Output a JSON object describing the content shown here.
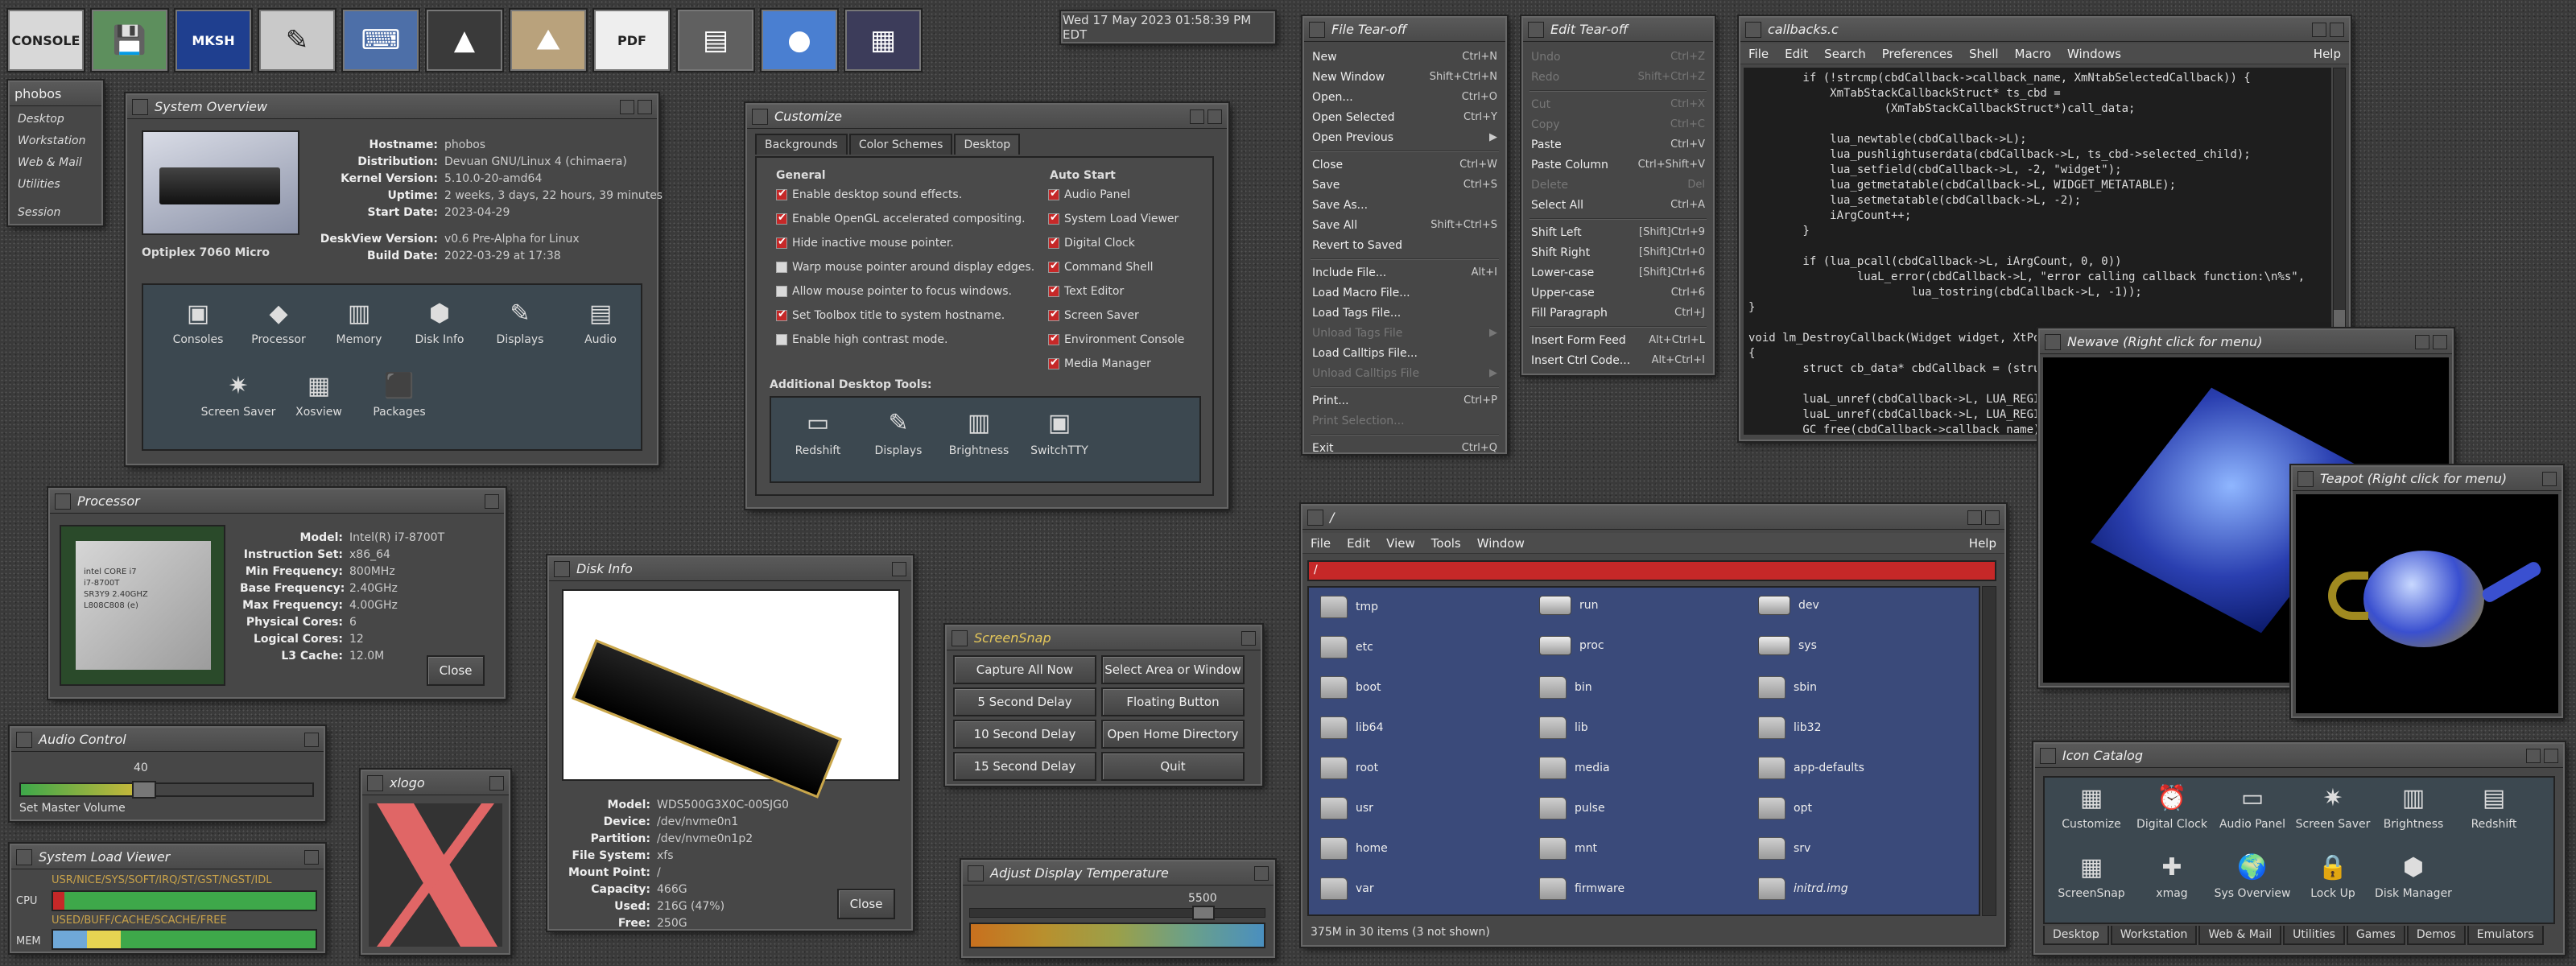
{
  "launcher": [
    {
      "name": "console-launcher",
      "label": "CONSOLE",
      "bg": "#d8d8d8"
    },
    {
      "name": "disk-launcher",
      "label": "💾",
      "bg": "#5d8f5d"
    },
    {
      "name": "mksh-launcher",
      "label": "MKSH",
      "bg": "#1f3f8f"
    },
    {
      "name": "editor-launcher",
      "label": "✎",
      "bg": "#c9c9c9"
    },
    {
      "name": "keyboard-launcher",
      "label": "⌨",
      "bg": "#4d6fa8"
    },
    {
      "name": "vlc-launcher",
      "label": "▲",
      "bg": "#3a3a3a"
    },
    {
      "name": "desert-launcher",
      "label": "⛰",
      "bg": "#b9a27c"
    },
    {
      "name": "pdf-launcher",
      "label": "PDF",
      "bg": "#eeeeee"
    },
    {
      "name": "files-launcher",
      "label": "▤",
      "bg": "#606060"
    },
    {
      "name": "globe-launcher",
      "label": "●",
      "bg": "#4a7fd1"
    },
    {
      "name": "workspaces-launcher",
      "label": "▦",
      "bg": "#3c3c5a"
    }
  ],
  "clock": "Wed 17 May 2023 01:58:39 PM EDT",
  "root_menu": {
    "title": "phobos",
    "items": [
      "Desktop",
      "Workstation",
      "Web & Mail",
      "Utilities",
      "Session"
    ]
  },
  "system_overview": {
    "title": "System Overview",
    "hostname_k": "Hostname:",
    "hostname": "phobos",
    "dist_k": "Distribution:",
    "dist": "Devuan GNU/Linux 4 (chimaera)",
    "kernel_k": "Kernel Version:",
    "kernel": "5.10.0-20-amd64",
    "uptime_k": "Uptime:",
    "uptime": "2 weeks, 3 days, 22 hours, 39 minutes",
    "start_k": "Start Date:",
    "start": "2023-04-29",
    "deskview_k": "DeskView Version:",
    "deskview": "v0.6 Pre-Alpha for Linux",
    "build_k": "Build Date:",
    "build": "2022-03-29 at 17:38",
    "machine": "Optiplex 7060 Micro",
    "icons": [
      "Consoles",
      "Processor",
      "Memory",
      "Disk Info",
      "Displays",
      "Audio",
      "Screen Saver",
      "Xosview",
      "Packages"
    ]
  },
  "customize": {
    "title": "Customize",
    "tabs": [
      "Backgrounds",
      "Color Schemes",
      "Desktop"
    ],
    "general_h": "General",
    "autostart_h": "Auto Start",
    "general": [
      {
        "t": "Enable desktop sound effects.",
        "on": true
      },
      {
        "t": "Enable OpenGL accelerated compositing.",
        "on": true
      },
      {
        "t": "Hide inactive mouse pointer.",
        "on": true
      },
      {
        "t": "Warp mouse pointer around display edges.",
        "on": false
      },
      {
        "t": "Allow mouse pointer to focus windows.",
        "on": false
      },
      {
        "t": "Set Toolbox title to system hostname.",
        "on": true
      },
      {
        "t": "Enable high contrast mode.",
        "on": false
      }
    ],
    "autostart": [
      {
        "t": "Audio Panel",
        "on": true
      },
      {
        "t": "System Load Viewer",
        "on": true
      },
      {
        "t": "Digital Clock",
        "on": true
      },
      {
        "t": "Command Shell",
        "on": true
      },
      {
        "t": "Text Editor",
        "on": true
      },
      {
        "t": "Screen Saver",
        "on": true
      },
      {
        "t": "Environment Console",
        "on": true
      },
      {
        "t": "Media Manager",
        "on": true
      }
    ],
    "tools_h": "Additional Desktop Tools:",
    "tools": [
      "Redshift",
      "Displays",
      "Brightness",
      "SwitchTTY"
    ]
  },
  "file_tearoff": {
    "title": "File Tear-off",
    "items": [
      {
        "t": "New",
        "a": "Ctrl+N"
      },
      {
        "t": "New Window",
        "a": "Shift+Ctrl+N"
      },
      {
        "t": "Open...",
        "a": "Ctrl+O"
      },
      {
        "t": "Open Selected",
        "a": "Ctrl+Y"
      },
      {
        "t": "Open Previous",
        "a": "▶"
      },
      {
        "sep": true
      },
      {
        "t": "Close",
        "a": "Ctrl+W"
      },
      {
        "t": "Save",
        "a": "Ctrl+S"
      },
      {
        "t": "Save As...",
        "a": ""
      },
      {
        "t": "Save All",
        "a": "Shift+Ctrl+S"
      },
      {
        "t": "Revert to Saved",
        "a": ""
      },
      {
        "sep": true
      },
      {
        "t": "Include File...",
        "a": "Alt+I"
      },
      {
        "t": "Load Macro File...",
        "a": ""
      },
      {
        "t": "Load Tags File...",
        "a": ""
      },
      {
        "t": "Unload Tags File",
        "a": "▶",
        "dis": true
      },
      {
        "t": "Load Calltips File...",
        "a": ""
      },
      {
        "t": "Unload Calltips File",
        "a": "▶",
        "dis": true
      },
      {
        "sep": true
      },
      {
        "t": "Print...",
        "a": "Ctrl+P"
      },
      {
        "t": "Print Selection...",
        "a": "",
        "dis": true
      },
      {
        "sep": true
      },
      {
        "t": "Exit",
        "a": "Ctrl+Q"
      }
    ]
  },
  "edit_tearoff": {
    "title": "Edit Tear-off",
    "items": [
      {
        "t": "Undo",
        "a": "Ctrl+Z",
        "dis": true
      },
      {
        "t": "Redo",
        "a": "Shift+Ctrl+Z",
        "dis": true
      },
      {
        "sep": true
      },
      {
        "t": "Cut",
        "a": "Ctrl+X",
        "dis": true
      },
      {
        "t": "Copy",
        "a": "Ctrl+C",
        "dis": true
      },
      {
        "t": "Paste",
        "a": "Ctrl+V"
      },
      {
        "t": "Paste Column",
        "a": "Ctrl+Shift+V"
      },
      {
        "t": "Delete",
        "a": "Del",
        "dis": true
      },
      {
        "t": "Select All",
        "a": "Ctrl+A"
      },
      {
        "sep": true
      },
      {
        "t": "Shift Left",
        "a": "[Shift]Ctrl+9"
      },
      {
        "t": "Shift Right",
        "a": "[Shift]Ctrl+0"
      },
      {
        "t": "Lower-case",
        "a": "[Shift]Ctrl+6"
      },
      {
        "t": "Upper-case",
        "a": "Ctrl+6"
      },
      {
        "t": "Fill Paragraph",
        "a": "Ctrl+J"
      },
      {
        "sep": true
      },
      {
        "t": "Insert Form Feed",
        "a": "Alt+Ctrl+L"
      },
      {
        "t": "Insert Ctrl Code...",
        "a": "Alt+Ctrl+I"
      }
    ]
  },
  "editor": {
    "title": "callbacks.c",
    "menu": [
      "File",
      "Edit",
      "Search",
      "Preferences",
      "Shell",
      "Macro",
      "Windows"
    ],
    "help": "Help",
    "code": "        if (!strcmp(cbdCallback->callback_name, XmNtabSelectedCallback)) {\n            XmTabStackCallbackStruct* ts_cbd =\n                    (XmTabStackCallbackStruct*)call_data;\n\n            lua_newtable(cbdCallback->L);\n            lua_pushlightuserdata(cbdCallback->L, ts_cbd->selected_child);\n            lua_setfield(cbdCallback->L, -2, \"widget\");\n            lua_getmetatable(cbdCallback->L, WIDGET_METATABLE);\n            lua_setmetatable(cbdCallback->L, -2);\n            iArgCount++;\n        }\n\n        if (lua_pcall(cbdCallback->L, iArgCount, 0, 0))\n                luaL_error(cbdCallback->L, \"error calling callback function:\\n%s\",\n                        lua_tostring(cbdCallback->L, -1));\n}\n\nvoid lm_DestroyCallback(Widget widget, XtPointer client_data, XtPointer call_data)\n{\n        struct cb_data* cbdCallback = (struc\n\n        luaL_unref(cbdCallback->L, LUA_REGIS\n        luaL_unref(cbdCallback->L, LUA_REGIS\n        GC_free(cbdCallback->callback_name);\n        GC_free(cbdCallback);\n}"
  },
  "newave": {
    "title": "Newave (Right click for menu)"
  },
  "teapot": {
    "title": "Teapot (Right click for menu)"
  },
  "processor": {
    "title": "Processor",
    "rows": [
      [
        "Model:",
        "Intel(R) i7-8700T"
      ],
      [
        "Instruction Set:",
        "x86_64"
      ],
      [
        "Min Frequency:",
        "800MHz"
      ],
      [
        "Base Frequency:",
        "2.40GHz"
      ],
      [
        "Max Frequency:",
        "4.00GHz"
      ],
      [
        "Physical Cores:",
        "6"
      ],
      [
        "Logical Cores:",
        "12"
      ],
      [
        "L3 Cache:",
        "12.0M"
      ]
    ],
    "close": "Close",
    "chip": "intel CORE i7\ni7-8700T\nSR3Y9 2.40GHZ\nL808C808 (e)"
  },
  "disk_info": {
    "title": "Disk Info",
    "rows": [
      [
        "Model:",
        "WDS500G3X0C-00SJG0"
      ],
      [
        "Device:",
        "/dev/nvme0n1"
      ],
      [
        "Partition:",
        "/dev/nvme0n1p2"
      ],
      [
        "File System:",
        "xfs"
      ],
      [
        "Mount Point:",
        "/"
      ],
      [
        "Capacity:",
        "466G"
      ],
      [
        "Used:",
        "216G  (47%)"
      ],
      [
        "Free:",
        "250G"
      ]
    ],
    "close": "Close"
  },
  "screensnap": {
    "title": "ScreenSnap",
    "buttons": [
      "Capture All Now",
      "Select Area or Window",
      "5 Second Delay",
      "Floating Button",
      "10 Second Delay",
      "Open Home Directory",
      "15 Second Delay",
      "Quit"
    ]
  },
  "display_temp": {
    "title": "Adjust Display Temperature",
    "value": "5500"
  },
  "audio": {
    "title": "Audio Control",
    "value": "40",
    "label": "Set Master Volume"
  },
  "load_viewer": {
    "title": "System Load Viewer",
    "cpu": "CPU",
    "mem": "MEM",
    "cpu_legend": "USR/NICE/SYS/SOFT/IRQ/ST/GST/NGST/IDL",
    "mem_legend": "USED/BUFF/CACHE/SCACHE/FREE"
  },
  "xlogo": {
    "title": "xlogo"
  },
  "file_manager": {
    "title": "/",
    "menu": [
      "File",
      "Edit",
      "View",
      "Tools",
      "Window"
    ],
    "help": "Help",
    "path": "/",
    "status": "375M in 30 items (3 not shown)",
    "col1": [
      "tmp",
      "etc",
      "boot",
      "lib64",
      "root",
      "usr",
      "home",
      "var"
    ],
    "col2": [
      "run",
      "proc",
      "bin",
      "lib",
      "media",
      "pulse",
      "mnt",
      "firmware"
    ],
    "col3": [
      "dev",
      "sys",
      "sbin",
      "lib32",
      "app-defaults",
      "opt",
      "srv",
      "initrd.img"
    ]
  },
  "icon_catalog": {
    "title": "Icon Catalog",
    "row1": [
      "Customize",
      "Digital Clock",
      "Audio Panel",
      "Screen Saver",
      "Brightness",
      "Redshift"
    ],
    "row2": [
      "ScreenSnap",
      "xmag",
      "Sys Overview",
      "Lock Up",
      "Disk Manager"
    ],
    "tabs": [
      "Desktop",
      "Workstation",
      "Web & Mail",
      "Utilities",
      "Games",
      "Demos",
      "Emulators"
    ]
  },
  "colors": {
    "red_bar": "#c62828",
    "selection": "#3a4a7a",
    "green": "#3ea84a"
  }
}
